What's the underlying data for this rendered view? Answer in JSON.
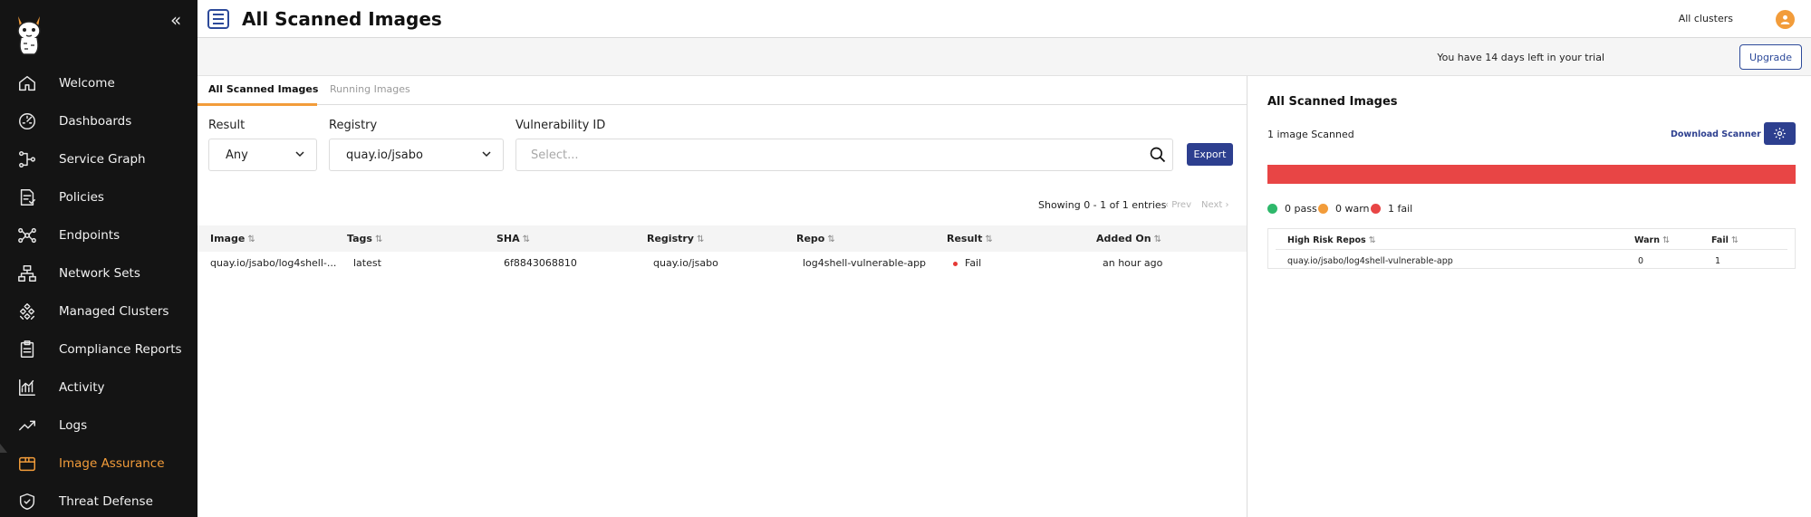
{
  "header": {
    "title": "All Scanned Images",
    "cluster": "All clusters"
  },
  "trial": {
    "text": "You have 14 days left in your trial",
    "upgrade_label": "Upgrade"
  },
  "sidebar": {
    "items": [
      {
        "label": "Welcome",
        "icon": "home-icon"
      },
      {
        "label": "Dashboards",
        "icon": "dashboard-icon"
      },
      {
        "label": "Service Graph",
        "icon": "service-graph-icon"
      },
      {
        "label": "Policies",
        "icon": "policies-icon"
      },
      {
        "label": "Endpoints",
        "icon": "endpoints-icon"
      },
      {
        "label": "Network Sets",
        "icon": "network-sets-icon"
      },
      {
        "label": "Managed Clusters",
        "icon": "clusters-icon"
      },
      {
        "label": "Compliance Reports",
        "icon": "clipboard-icon"
      },
      {
        "label": "Activity",
        "icon": "activity-icon"
      },
      {
        "label": "Logs",
        "icon": "logs-icon"
      },
      {
        "label": "Image Assurance",
        "icon": "box-icon",
        "active": true
      },
      {
        "label": "Threat Defense",
        "icon": "shield-icon"
      }
    ],
    "accent": "#f29c3a"
  },
  "tabs": [
    {
      "label": "All Scanned Images",
      "active": true
    },
    {
      "label": "Running Images",
      "active": false
    }
  ],
  "filters": {
    "result_label": "Result",
    "result_value": "Any",
    "registry_label": "Registry",
    "registry_value": "quay.io/jsabo",
    "vuln_label": "Vulnerability ID",
    "vuln_placeholder": "Select...",
    "export_label": "Export"
  },
  "pagination": {
    "showing": "Showing 0 - 1 of 1 entries",
    "prev": "Prev",
    "next": "Next"
  },
  "table": {
    "headers": [
      "Image",
      "Tags",
      "SHA",
      "Registry",
      "Repo",
      "Result",
      "Added On"
    ],
    "rows": [
      {
        "image": "quay.io/jsabo/log4shell-...",
        "tags": "latest",
        "sha": "6f8843068810",
        "registry": "quay.io/jsabo",
        "repo": "log4shell-vulnerable-app",
        "result": "Fail",
        "added_on": "an hour ago"
      }
    ]
  },
  "panel": {
    "title": "All Scanned Images",
    "count": "1 image Scanned",
    "download_label": "Download Scanner",
    "fail_color": "#e84545",
    "bar": {
      "pass": 0,
      "warn": 0,
      "fail": 1
    },
    "legend": [
      {
        "label": "0 pass",
        "color": "#2eb86b"
      },
      {
        "label": "0 warn",
        "color": "#f29c3a"
      },
      {
        "label": "1 fail",
        "color": "#e84545"
      }
    ],
    "risk_table": {
      "headers": [
        "High Risk Repos",
        "Warn",
        "Fail"
      ],
      "rows": [
        {
          "repo": "quay.io/jsabo/log4shell-vulnerable-app",
          "warn": "0",
          "fail": "1"
        }
      ]
    }
  }
}
